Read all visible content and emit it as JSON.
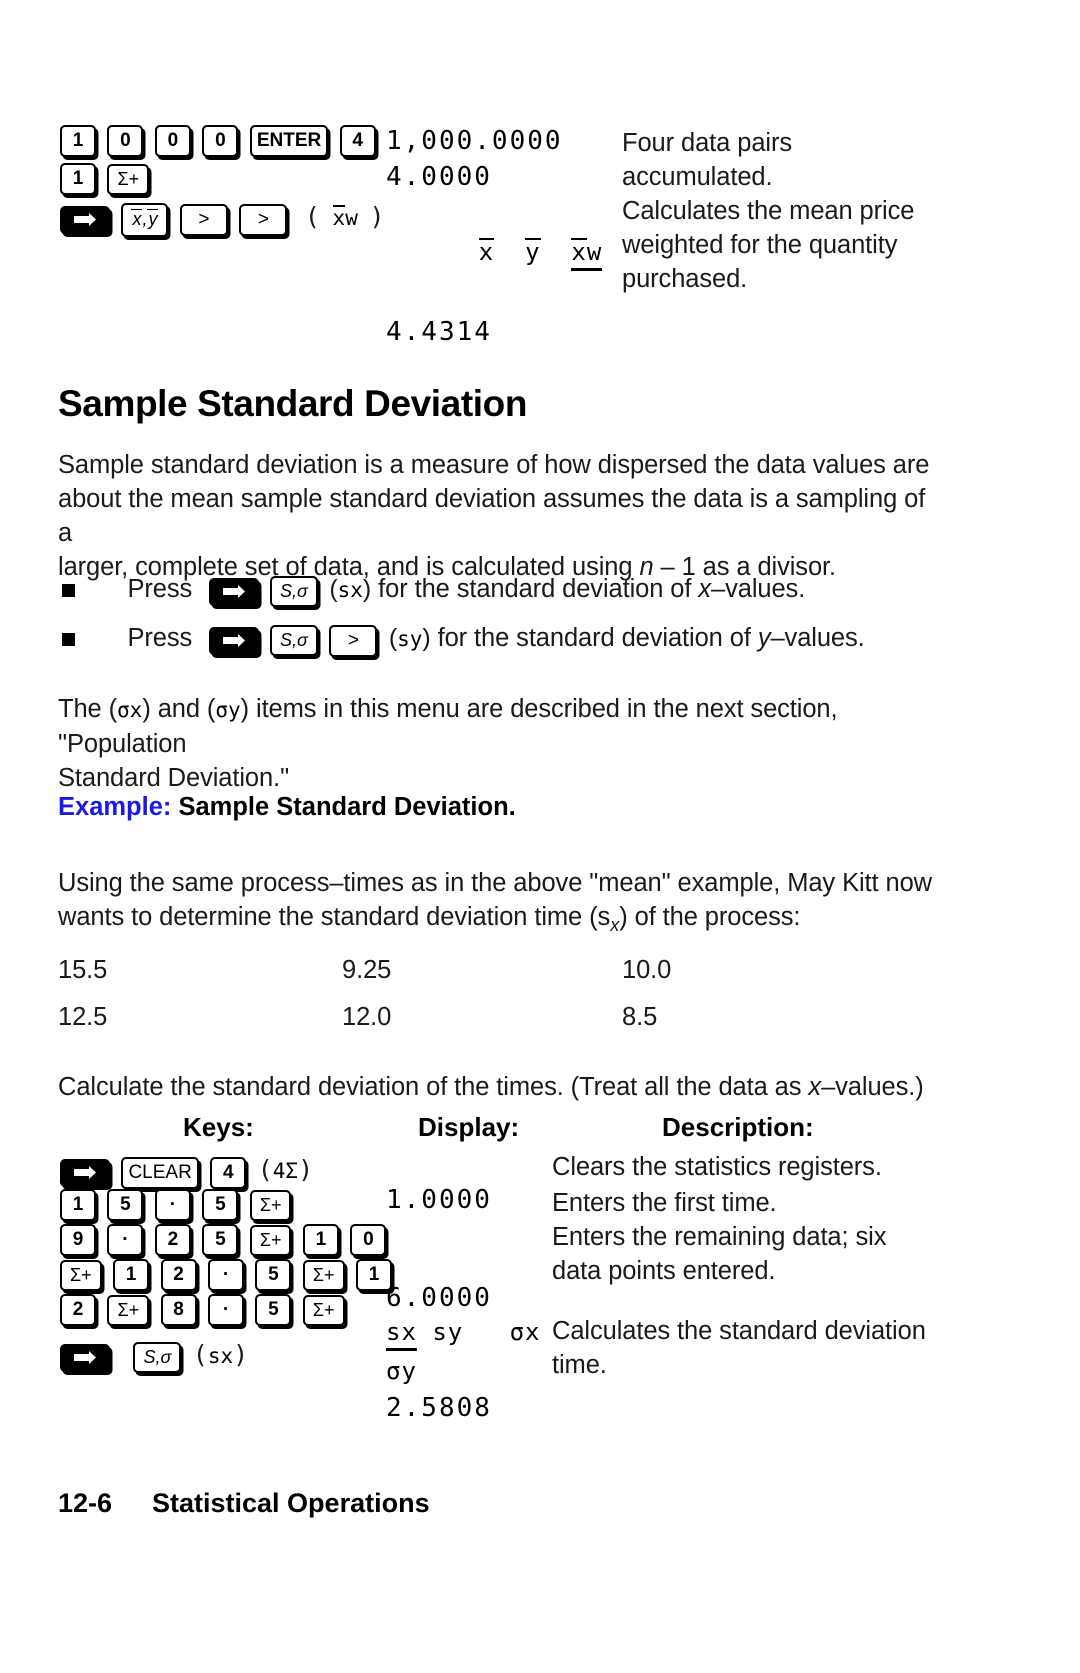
{
  "top_example": {
    "keys_rows": [
      [
        "1",
        "0",
        "0",
        "0",
        "ENTER",
        "4"
      ],
      [
        "1",
        "Σ+"
      ],
      [
        "shift",
        "x̄,ȳ",
        ">",
        ">"
      ]
    ],
    "keys_row3_annotation": "( x̄w )",
    "display_lines": [
      "1,000.0000",
      "4.0000"
    ],
    "display_menu": [
      "x̄",
      "ȳ",
      "x̄w"
    ],
    "display_menu_selected": "x̄w",
    "display_result": "4.4314",
    "description_lines": [
      "Four data pairs",
      "accumulated.",
      "Calculates the mean price",
      "weighted for the quantity",
      "purchased."
    ]
  },
  "section": {
    "title": "Sample Standard Deviation",
    "intro_lines": [
      "Sample standard deviation is a measure of how dispersed the data values are",
      "about the mean sample standard deviation assumes the data is a sampling of a",
      "larger, complete set of data, and is calculated using n – 1 as a divisor."
    ],
    "bullets": [
      {
        "press_label": "Press",
        "keys": [
          "shift",
          "S,σ"
        ],
        "annotation": "(s x)",
        "annotation_raw": "sx",
        "tail_before_italic": "for the standard deviation of ",
        "italic_var": "x",
        "tail_after_italic": "–values."
      },
      {
        "press_label": "Press",
        "keys": [
          "shift",
          "S,σ",
          ">"
        ],
        "annotation": "(s y)",
        "annotation_raw": "sy",
        "tail_before_italic": "for the standard deviation of ",
        "italic_var": "y",
        "tail_after_italic": "–values."
      }
    ],
    "note_lines": [
      "The (σx) and (σy) items in this menu are described in the next section, \"Population",
      "Standard Deviation.\""
    ],
    "note_parts": {
      "p1": "The (",
      "sigx": "σx",
      "p2": ") and (",
      "sigy": "σy",
      "p3": ") items in this menu are described in the next section, \"Population",
      "line2": "Standard Deviation.\""
    }
  },
  "example": {
    "label": "Example:",
    "title": "Sample Standard Deviation.",
    "intro_lines": [
      "Using the same process–times as in the above \"mean\" example, May Kitt now",
      "wants to determine the standard deviation time (sₓ) of the process:"
    ],
    "intro_line2_prefix": "wants to determine the standard deviation time (s",
    "intro_line2_sub": "x",
    "intro_line2_suffix": ") of the process:",
    "data_rows": [
      [
        "15.5",
        "9.25",
        "10.0"
      ],
      [
        "12.5",
        "12.0",
        "8.5"
      ]
    ],
    "instruction_prefix": "Calculate the standard deviation of the times. (Treat all the data as ",
    "instruction_italic": "x",
    "instruction_suffix": "–values.)"
  },
  "table": {
    "headers": {
      "keys": "Keys:",
      "display": "Display:",
      "description": "Description:"
    },
    "rows": [
      {
        "keys": [
          "shift",
          "CLEAR",
          "4"
        ],
        "annotation": "(4Σ)",
        "display": "",
        "description": "Clears the statistics registers."
      },
      {
        "keys": [
          "1",
          "5",
          "·",
          "5",
          "Σ+"
        ],
        "annotation": "",
        "display": "1.0000",
        "description": "Enters the first time."
      },
      {
        "keys": [
          "9",
          "·",
          "2",
          "5",
          "Σ+",
          "1",
          "0"
        ],
        "annotation": "",
        "display": "",
        "description": "Enters the remaining data; six"
      },
      {
        "keys": [
          "Σ+",
          "1",
          "2",
          "·",
          "5",
          "Σ+",
          "1"
        ],
        "annotation": "",
        "display": "",
        "description": "data points entered."
      },
      {
        "keys": [
          "2",
          "Σ+",
          "8",
          "·",
          "5",
          "Σ+"
        ],
        "annotation": "",
        "display": "6.0000",
        "description": ""
      },
      {
        "keys": [
          "shift",
          "S,σ"
        ],
        "annotation": "(sx)",
        "display": "",
        "description": "Calculates the standard deviation"
      }
    ],
    "final_display": {
      "menu": [
        "sx",
        "sy",
        "σx"
      ],
      "menu_selected": "sx",
      "menu_line2": "σy",
      "result": "2.5808"
    },
    "final_description": "time."
  },
  "footer": {
    "page_number": "12-6",
    "chapter": "Statistical Operations"
  }
}
